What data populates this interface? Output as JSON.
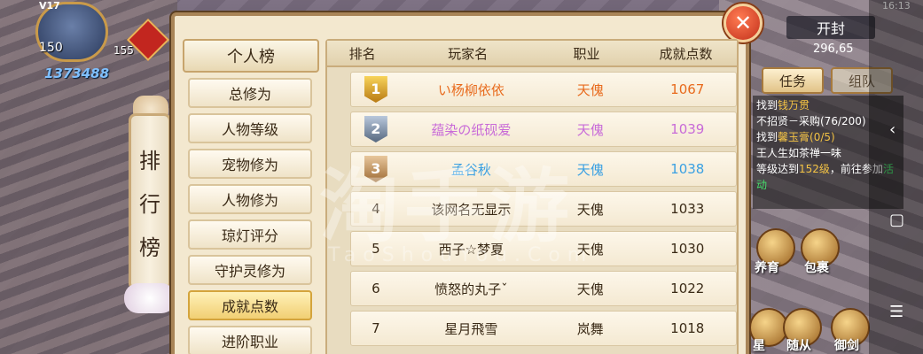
{
  "player": {
    "vip": "V17",
    "level": "150",
    "level2": "155",
    "power": "1373488"
  },
  "scroll_title": [
    "排",
    "行",
    "榜"
  ],
  "panel": {
    "category_header": "个人榜",
    "categories": [
      {
        "label": "总修为",
        "active": false
      },
      {
        "label": "人物等级",
        "active": false
      },
      {
        "label": "宠物修为",
        "active": false
      },
      {
        "label": "人物修为",
        "active": false
      },
      {
        "label": "琼灯评分",
        "active": false
      },
      {
        "label": "守护灵修为",
        "active": false
      },
      {
        "label": "成就点数",
        "active": true
      },
      {
        "label": "进阶职业",
        "active": false
      }
    ],
    "table": {
      "headers": [
        "排名",
        "玩家名",
        "职业",
        "成就点数"
      ],
      "rows": [
        {
          "rank": "1",
          "name": "い杨柳依依",
          "job": "天傀",
          "points": "1067"
        },
        {
          "rank": "2",
          "name": "蕴染の纸砚爱",
          "job": "天傀",
          "points": "1039"
        },
        {
          "rank": "3",
          "name": "孟谷秋",
          "job": "天傀",
          "points": "1038"
        },
        {
          "rank": "4",
          "name": "该网名无显示",
          "job": "天傀",
          "points": "1033"
        },
        {
          "rank": "5",
          "name": "西子☆梦夏",
          "job": "天傀",
          "points": "1030"
        },
        {
          "rank": "6",
          "name": "愤怒的丸子ˇ",
          "job": "天傀",
          "points": "1022"
        },
        {
          "rank": "7",
          "name": "星月飛雪",
          "job": "岚舞",
          "points": "1018"
        }
      ]
    }
  },
  "right_hud": {
    "time": "16:13",
    "open_label": "开封",
    "coords": "296,65",
    "task_tab": "任务",
    "team_tab": "组队",
    "task_lines": [
      "找到钱万贯",
      "不招贤－采购(76/200)",
      "找到馨玉膏(0/5)",
      "王人生如茶禅一味",
      "等级达到152级，前往参加活动"
    ],
    "task_highlights": {
      "npc": "钱万贯",
      "item": "馨玉膏(0/5)",
      "level": "152级",
      "activity": "活动"
    },
    "skills": [
      "养育",
      "包裹",
      "星",
      "随从",
      "御剑"
    ]
  },
  "watermark": {
    "main": "淘手游",
    "sub": "TaoShouYou.Com"
  }
}
